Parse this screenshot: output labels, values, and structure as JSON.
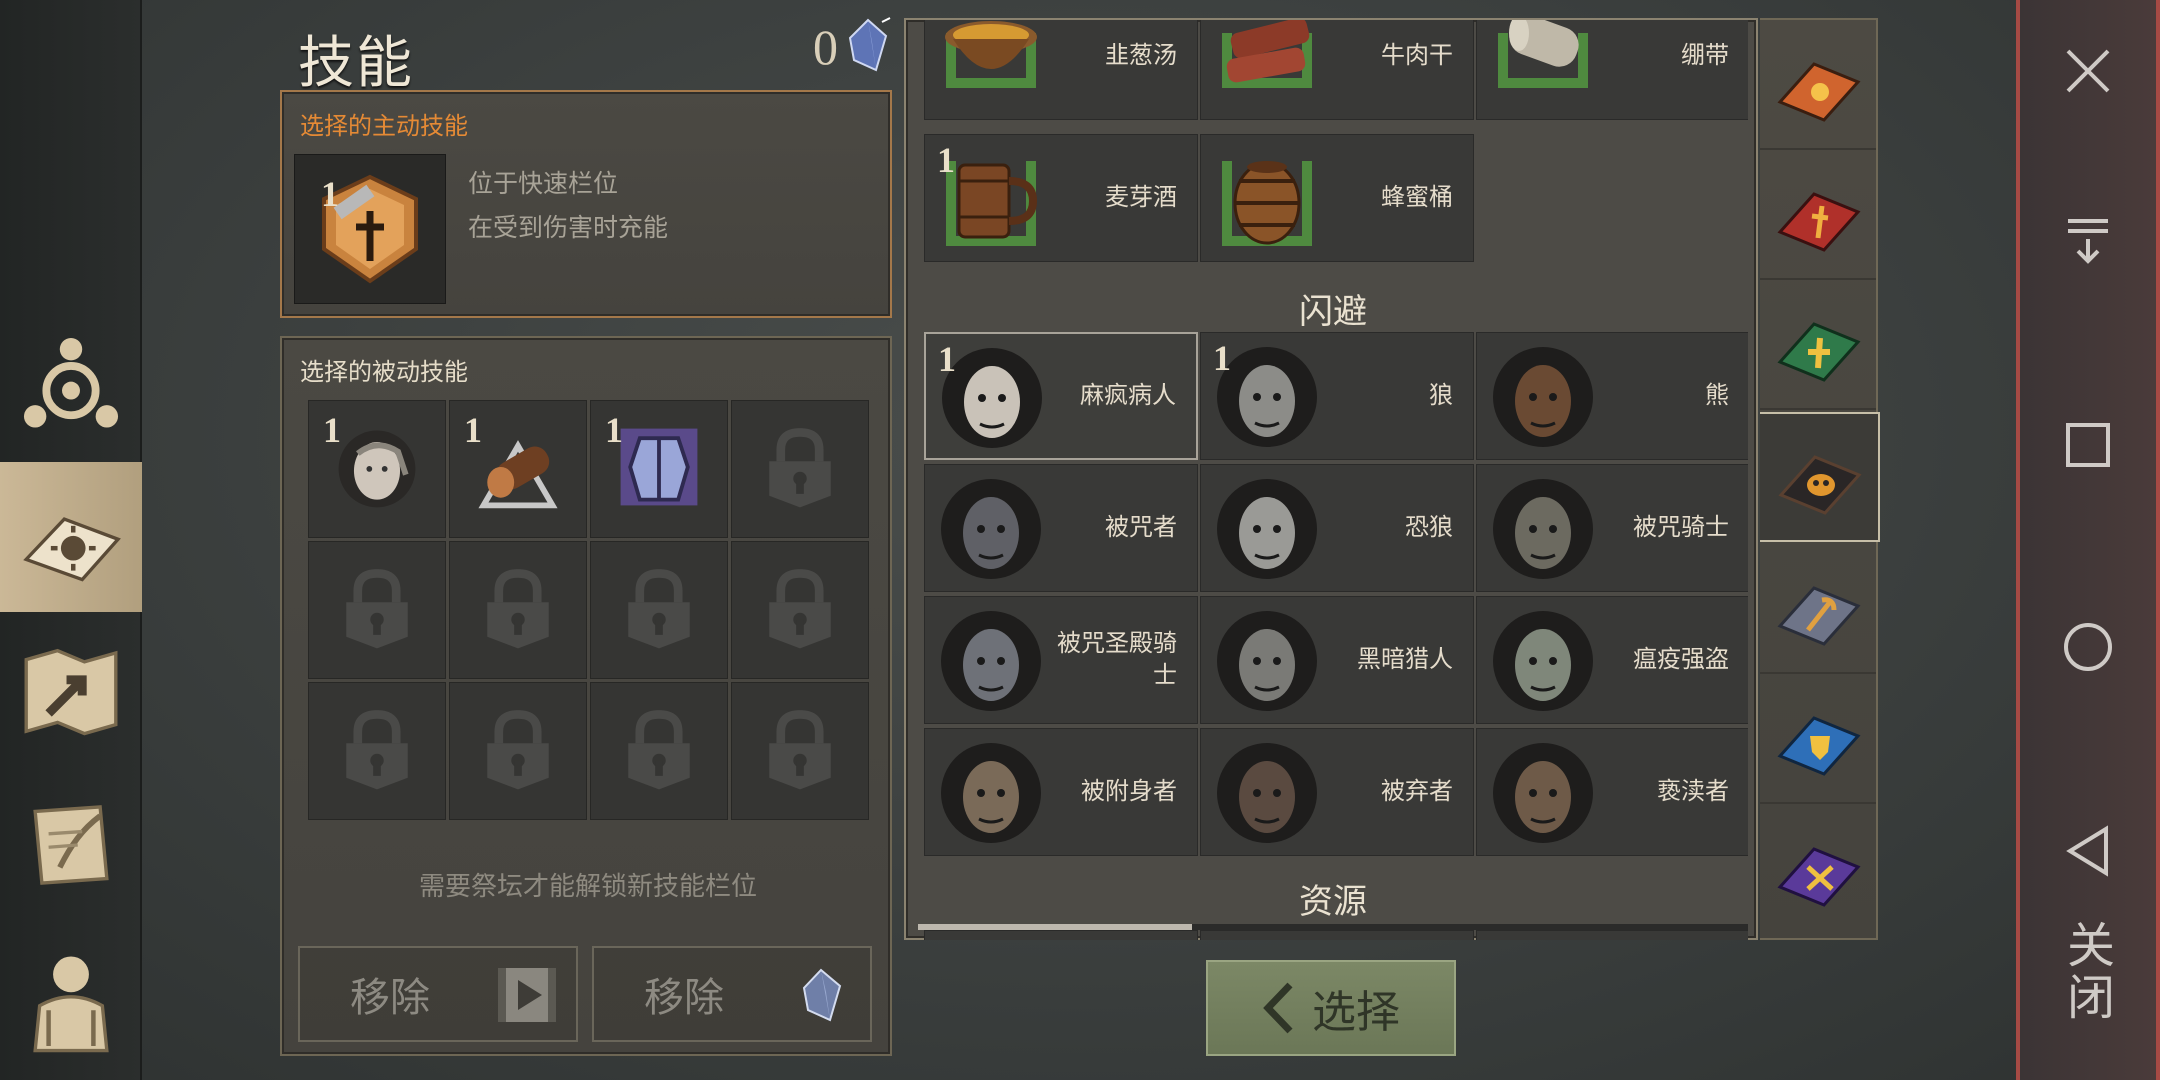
{
  "header": {
    "title": "技能",
    "gem_count": "0"
  },
  "active_skill": {
    "label": "选择的主动技能",
    "level": "1",
    "desc_line1": "位于快速栏位",
    "desc_line2": "在受到伤害时充能"
  },
  "passive_skills": {
    "label": "选择的被动技能",
    "slots": [
      {
        "level": "1",
        "icon": "pale-head-icon"
      },
      {
        "level": "1",
        "icon": "log-icon"
      },
      {
        "level": "1",
        "icon": "armor-icon"
      },
      {
        "level": "",
        "icon": "lock-icon"
      },
      {
        "level": "",
        "icon": "lock-icon"
      },
      {
        "level": "",
        "icon": "lock-icon"
      },
      {
        "level": "",
        "icon": "lock-icon"
      },
      {
        "level": "",
        "icon": "lock-icon"
      },
      {
        "level": "",
        "icon": "lock-icon"
      },
      {
        "level": "",
        "icon": "lock-icon"
      },
      {
        "level": "",
        "icon": "lock-icon"
      },
      {
        "level": "",
        "icon": "lock-icon"
      }
    ],
    "unlock_hint": "需要祭坛才能解锁新技能栏位",
    "remove_video": "移除",
    "remove_gem": "移除"
  },
  "food_items": [
    {
      "name": "韭葱汤",
      "icon": "soup-icon",
      "level": ""
    },
    {
      "name": "牛肉干",
      "icon": "jerky-icon",
      "level": ""
    },
    {
      "name": "绷带",
      "icon": "bandage-icon",
      "level": ""
    },
    {
      "name": "麦芽酒",
      "icon": "mug-icon",
      "level": "1"
    },
    {
      "name": "蜂蜜桶",
      "icon": "barrel-icon",
      "level": ""
    }
  ],
  "dodge_section": {
    "title": "闪避"
  },
  "dodge_items": [
    {
      "name": "麻疯病人",
      "level": "1",
      "tone": "#c9c2b8"
    },
    {
      "name": "狼",
      "level": "1",
      "tone": "#8c8c88"
    },
    {
      "name": "熊",
      "level": "",
      "tone": "#6a4a33"
    },
    {
      "name": "被咒者",
      "level": "",
      "tone": "#5f6066"
    },
    {
      "name": "恐狼",
      "level": "",
      "tone": "#9a9a96"
    },
    {
      "name": "被咒骑士",
      "level": "",
      "tone": "#6c6a60"
    },
    {
      "name": "被咒圣殿骑士",
      "level": "",
      "tone": "#6e7178"
    },
    {
      "name": "黑暗猎人",
      "level": "",
      "tone": "#7a7a76"
    },
    {
      "name": "瘟疫强盗",
      "level": "",
      "tone": "#7f877a"
    },
    {
      "name": "被附身者",
      "level": "",
      "tone": "#7a6a58"
    },
    {
      "name": "被弃者",
      "level": "",
      "tone": "#5a4a40"
    },
    {
      "name": "亵渎者",
      "level": "",
      "tone": "#6e5a48"
    }
  ],
  "resources_section": {
    "title": "资源"
  },
  "scroll_progress": 0.33,
  "select_button": {
    "label": "选择"
  },
  "system_bar": {
    "close_text": "关闭"
  },
  "colors": {
    "accent_orange": "#e58a35",
    "select_green": "#7c8866",
    "close_red": "#a64a44"
  }
}
